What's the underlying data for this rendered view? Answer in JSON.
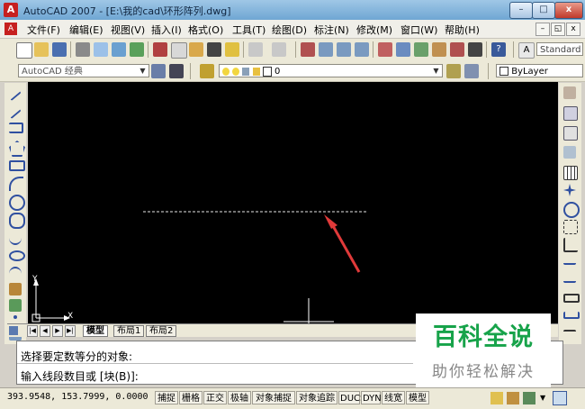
{
  "window": {
    "title": "AutoCAD 2007 - [E:\\我的cad\\环形阵列.dwg]",
    "controls": {
      "minimize": "–",
      "maximize": "□",
      "close": "x"
    }
  },
  "menubar": {
    "items": [
      "文件(F)",
      "编辑(E)",
      "视图(V)",
      "插入(I)",
      "格式(O)",
      "工具(T)",
      "绘图(D)",
      "标注(N)",
      "修改(M)",
      "窗口(W)",
      "帮助(H)"
    ],
    "mdi": {
      "minimize": "–",
      "restore": "◱",
      "close": "x"
    }
  },
  "toolbar": {
    "text_style": "Standard",
    "workspace": "AutoCAD 经典",
    "layer": "0",
    "linetype": "ByLayer"
  },
  "canvas": {
    "ucs_y": "Y",
    "ucs_x": "X"
  },
  "layout_tabs": [
    "模型",
    "布局1",
    "布局2"
  ],
  "command": {
    "line1": "选择要定数等分的对象:",
    "line2": "输入线段数目或 [块(B)]:"
  },
  "status": {
    "coords": "393.9548,  153.7999, 0.0000",
    "toggles": [
      "捕捉",
      "栅格",
      "正交",
      "极轴",
      "对象捕捉",
      "对象追踪",
      "DUCS",
      "DYN",
      "线宽",
      "模型"
    ]
  },
  "watermark": {
    "main": "百科全说",
    "sub": "助你轻松解决"
  },
  "colors": {
    "canvas_bg": "#000000",
    "arrow": "#e03a3a",
    "watermark_green": "#17a34a"
  }
}
